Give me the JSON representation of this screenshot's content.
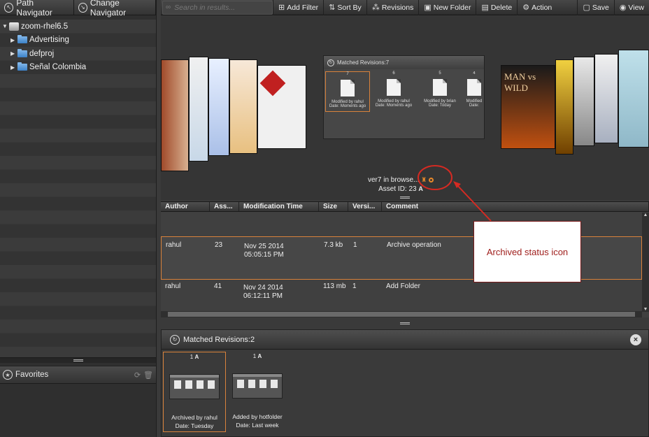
{
  "nav": {
    "tab_path": "Path Navigator",
    "tab_change": "Change Navigator"
  },
  "tree": [
    {
      "label": "zoom-rhel6.5",
      "level": 0,
      "icon": "server-icon",
      "expanded": true
    },
    {
      "label": "Advertising",
      "level": 1,
      "icon": "folder-icon"
    },
    {
      "label": "defproj",
      "level": 1,
      "icon": "folder-icon"
    },
    {
      "label": "Señal Colombia",
      "level": 1,
      "icon": "folder-icon"
    }
  ],
  "favorites": {
    "label": "Favorites"
  },
  "toolbar": {
    "search_placeholder": "Search in results...",
    "add_filter": "Add Filter",
    "sort_by": "Sort By",
    "revisions": "Revisions",
    "new_folder": "New Folder",
    "delete": "Delete",
    "action": "Action",
    "save": "Save",
    "view": "View"
  },
  "coverflow": {
    "revbox_title": "Matched Revisions:7",
    "revisions": [
      {
        "num": "7",
        "line1": "Modified by rahul",
        "line2": "Date: Moments ago"
      },
      {
        "num": "6",
        "line1": "Modified by rahul",
        "line2": "Date: Moments ago"
      },
      {
        "num": "5",
        "line1": "Modified by brian",
        "line2": "Date: Today"
      },
      {
        "num": "4",
        "line1": "Modified",
        "line2": "Date:"
      }
    ],
    "asset_name": "ver7 in browse...",
    "asset_id": "Asset ID: 23",
    "right_card_text": "MAN vs WILD"
  },
  "table": {
    "headers": [
      "Author",
      "Ass...",
      "Modification Time",
      "Size",
      "Versi...",
      "Comment"
    ],
    "rows": [
      {
        "author": "rahul",
        "asset": "23",
        "time1": "Nov 25 2014",
        "time2": "05:05:15 PM",
        "size": "7.3 kb",
        "version": "1",
        "comment": "Archive operation"
      },
      {
        "author": "rahul",
        "asset": "41",
        "time1": "Nov 24 2014",
        "time2": "06:12:11 PM",
        "size": "113 mb",
        "version": "1",
        "comment": "Add Folder"
      }
    ]
  },
  "matched": {
    "title": "Matched Revisions:2",
    "items": [
      {
        "num": "1",
        "line1": "Archived by rahul",
        "line2": "Date: Tuesday"
      },
      {
        "num": "1",
        "line1": "Added by hotfolder",
        "line2": "Date: Last week"
      }
    ]
  },
  "annotation": {
    "text": "Archived status icon",
    "color": "#c0201c"
  },
  "colors": {
    "accent": "#d9823b",
    "archive_icon": "#e8892a"
  }
}
